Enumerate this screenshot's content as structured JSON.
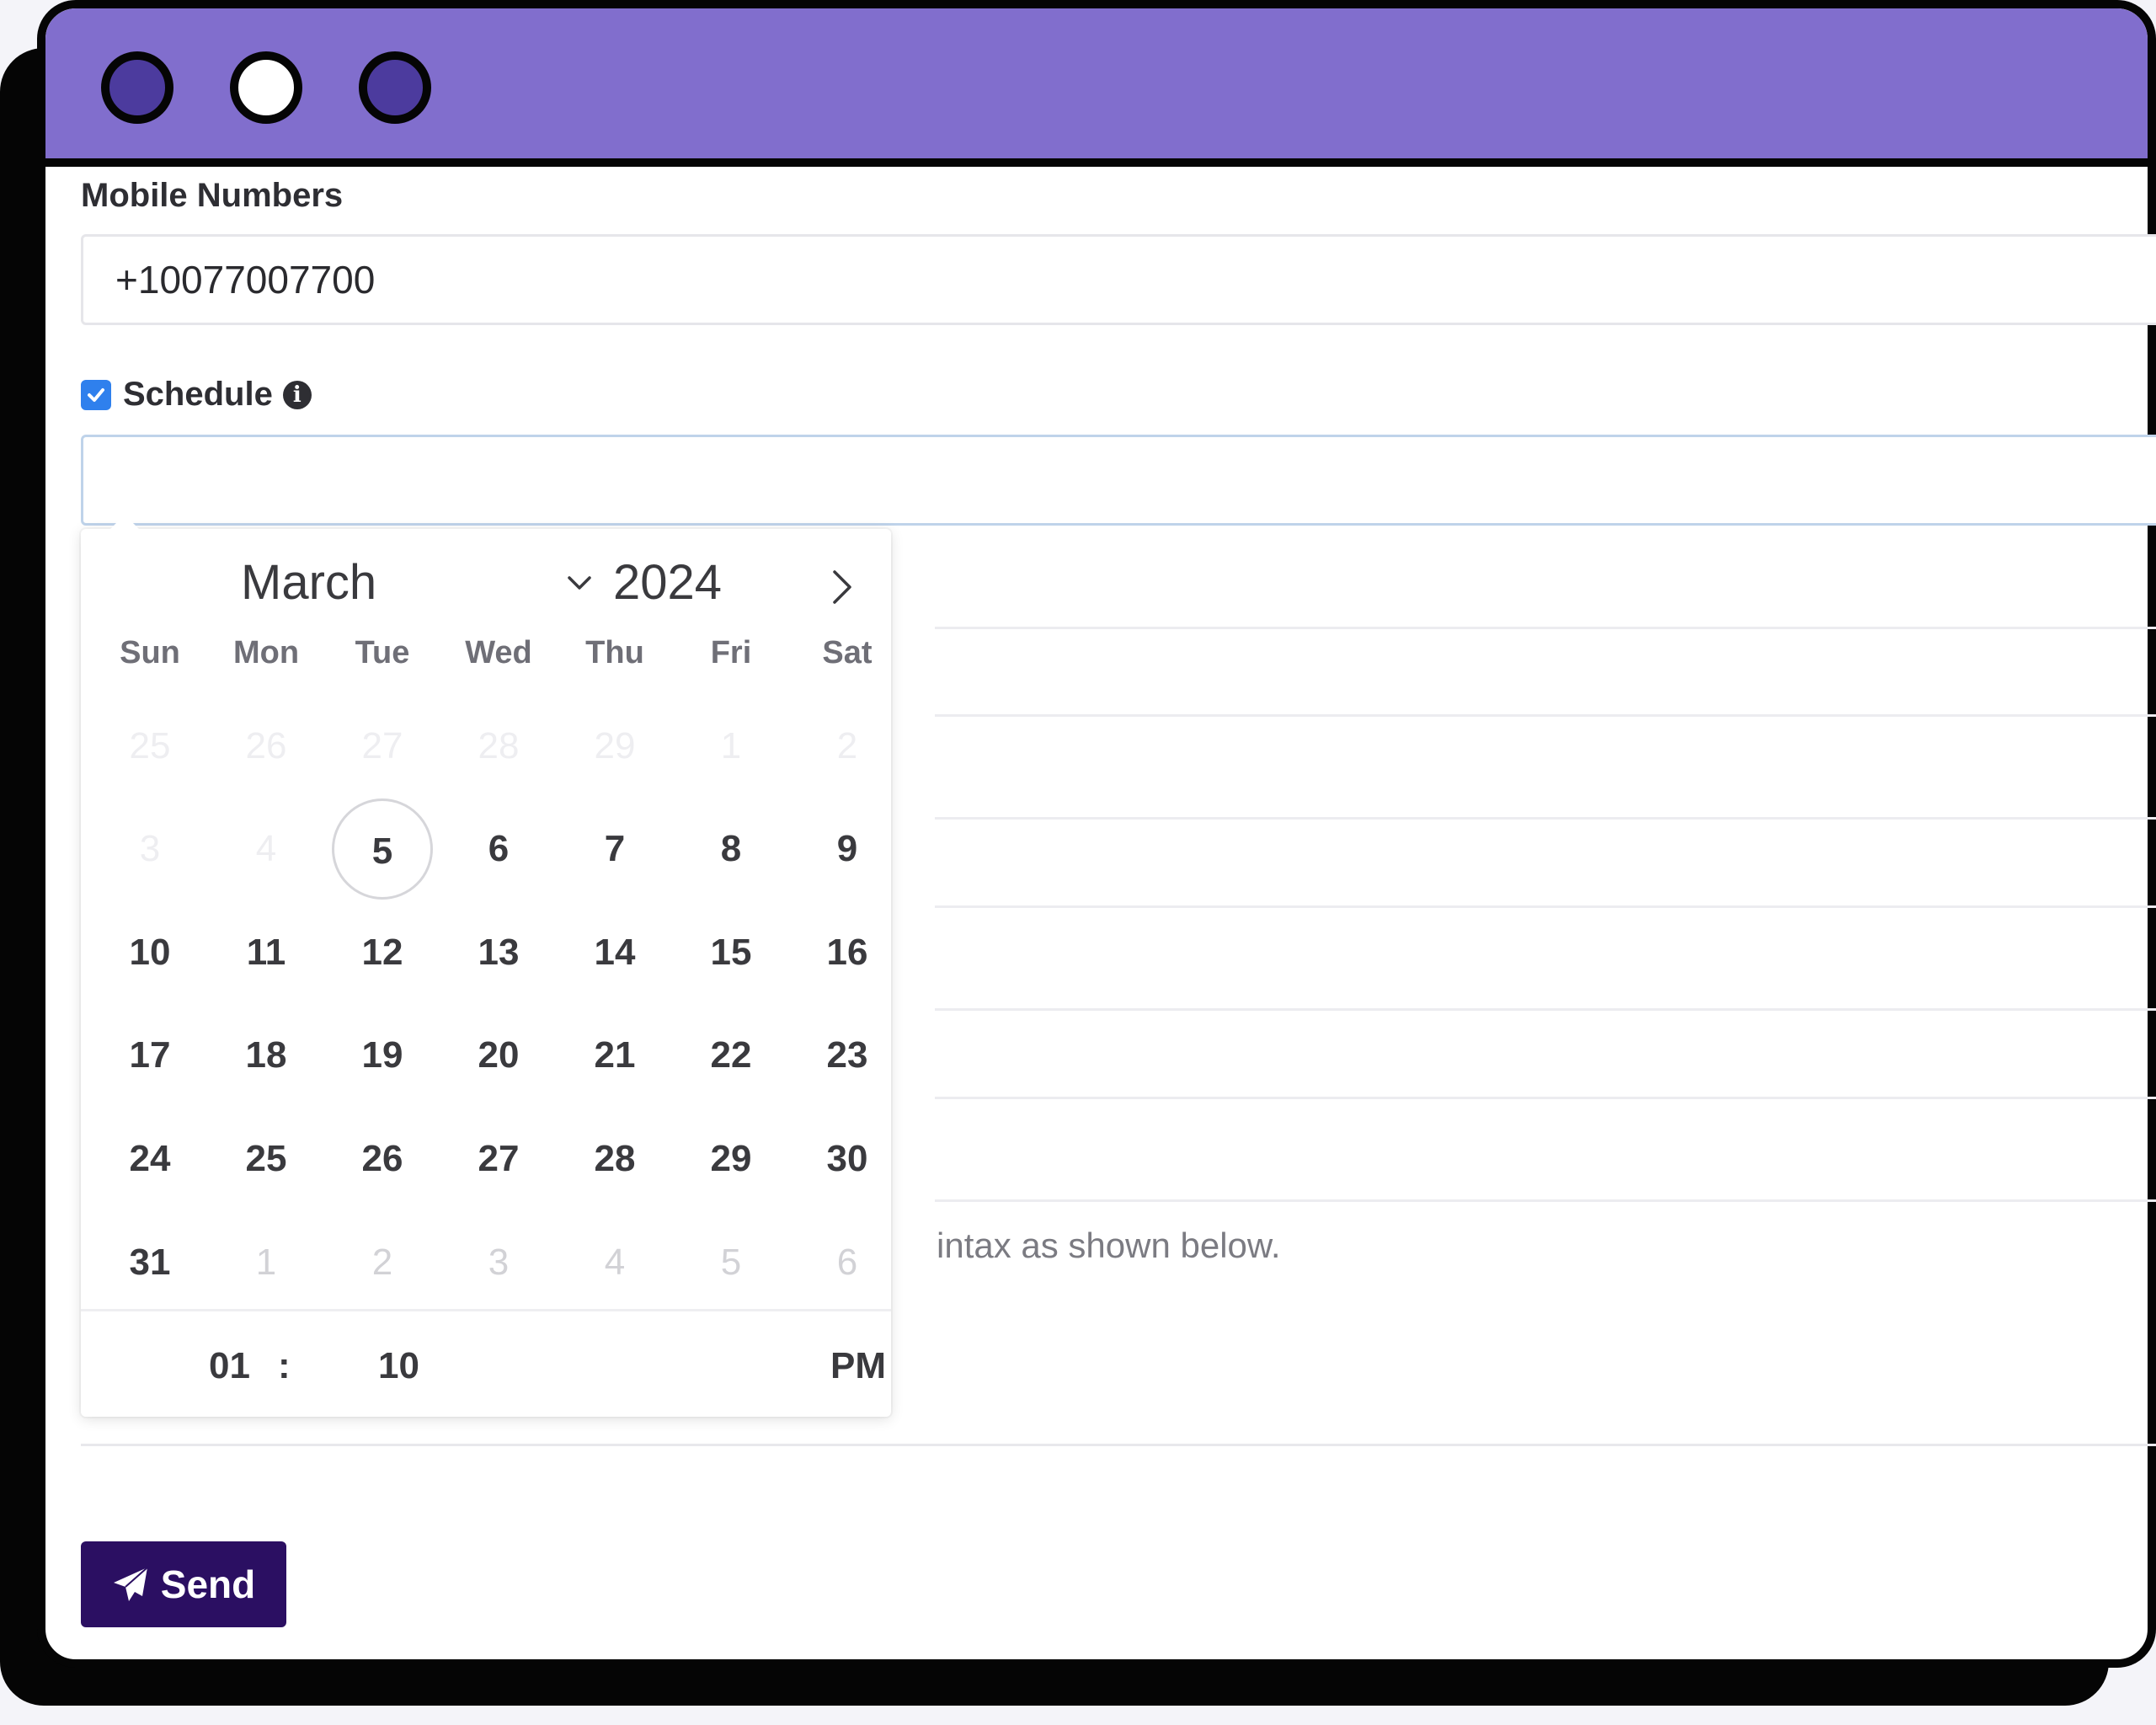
{
  "window": {
    "traffic_lights": [
      "close-dot",
      "minimize-dot",
      "maximize-dot"
    ]
  },
  "form": {
    "mobile_label": "Mobile Numbers",
    "mobile_value": "+10077007700",
    "schedule_label": "Schedule",
    "schedule_checked": true,
    "schedule_value": "",
    "hint_text": "intax as shown below.",
    "send_label": "Send"
  },
  "calendar": {
    "month": "March",
    "year": "2024",
    "weekdays": [
      "Sun",
      "Mon",
      "Tue",
      "Wed",
      "Thu",
      "Fri",
      "Sat"
    ],
    "weeks": [
      [
        "25",
        "26",
        "27",
        "28",
        "29",
        "1",
        "2"
      ],
      [
        "3",
        "4",
        "5",
        "6",
        "7",
        "8",
        "9"
      ],
      [
        "10",
        "11",
        "12",
        "13",
        "14",
        "15",
        "16"
      ],
      [
        "17",
        "18",
        "19",
        "20",
        "21",
        "22",
        "23"
      ],
      [
        "24",
        "25",
        "26",
        "27",
        "28",
        "29",
        "30"
      ],
      [
        "31",
        "1",
        "2",
        "3",
        "4",
        "5",
        "6"
      ]
    ],
    "today": "5",
    "time": {
      "hour": "01",
      "separator": ":",
      "minute": "10",
      "ampm": "PM"
    }
  },
  "colors": {
    "titlebar": "#816ecd",
    "send_button": "#2b0f62",
    "checkbox": "#2f80ed"
  }
}
